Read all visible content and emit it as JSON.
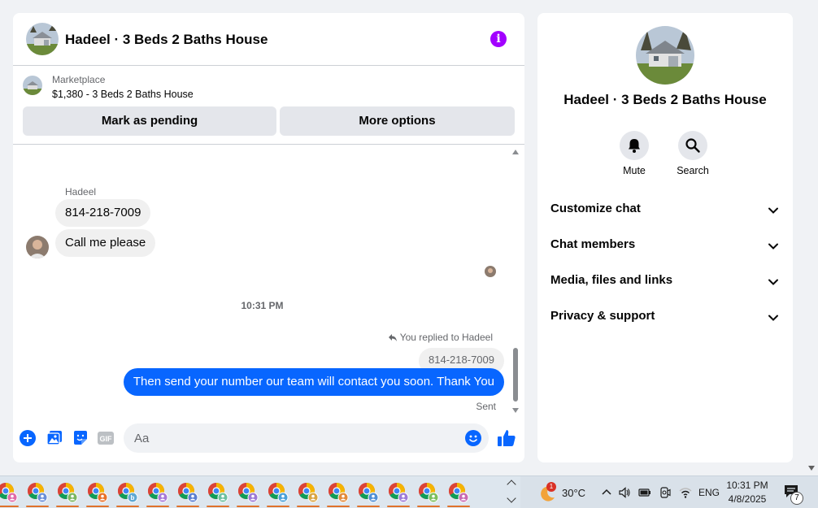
{
  "chat": {
    "title": "Hadeel · 3 Beds 2 Baths House",
    "info_icon": "info-icon"
  },
  "listing": {
    "label": "Marketplace",
    "price_title": "$1,380 - 3 Beds 2 Baths House",
    "mark_pending": "Mark as pending",
    "more_options": "More options"
  },
  "messages": {
    "sender_name": "Hadeel",
    "incoming": [
      "814-218-7009",
      "Call me please"
    ],
    "timestamp": "10:31 PM",
    "reply_note": "You replied to Hadeel",
    "quoted": "814-218-7009",
    "outgoing": "Then send your number our team will contact you soon. Thank You",
    "status": "Sent"
  },
  "composer": {
    "placeholder": "Aa",
    "gif_label": "GIF"
  },
  "info_panel": {
    "title": "Hadeel · 3 Beds 2 Baths House",
    "actions": [
      {
        "label": "Mute",
        "icon": "bell-icon"
      },
      {
        "label": "Search",
        "icon": "search-icon"
      }
    ],
    "sections": [
      "Customize chat",
      "Chat members",
      "Media, files and links",
      "Privacy & support"
    ]
  },
  "colors": {
    "accent_blue": "#0866ff",
    "info_purple": "#a200ff",
    "bubble_gray": "#f0f0f0"
  },
  "taskbar": {
    "app_icon": "chrome-icon",
    "profile_badge_colors": [
      "#e06ba8",
      "#6a8fd8",
      "#7bb661",
      "#e8712a",
      "#5fa8d3",
      "#a77ad8",
      "#5b7fd1",
      "#6cc0a0",
      "#9c7ad6",
      "#4aa0d8",
      "#d9a441",
      "#e28a3a",
      "#4f8fd6",
      "#9d7cd8",
      "#7cbf5e",
      "#c86bb3"
    ],
    "orange_letter": "b",
    "weather_badge": "1",
    "temperature": "30°C",
    "language": "ENG",
    "time": "10:31 PM",
    "date": "4/8/2025",
    "notification_count": "7"
  }
}
